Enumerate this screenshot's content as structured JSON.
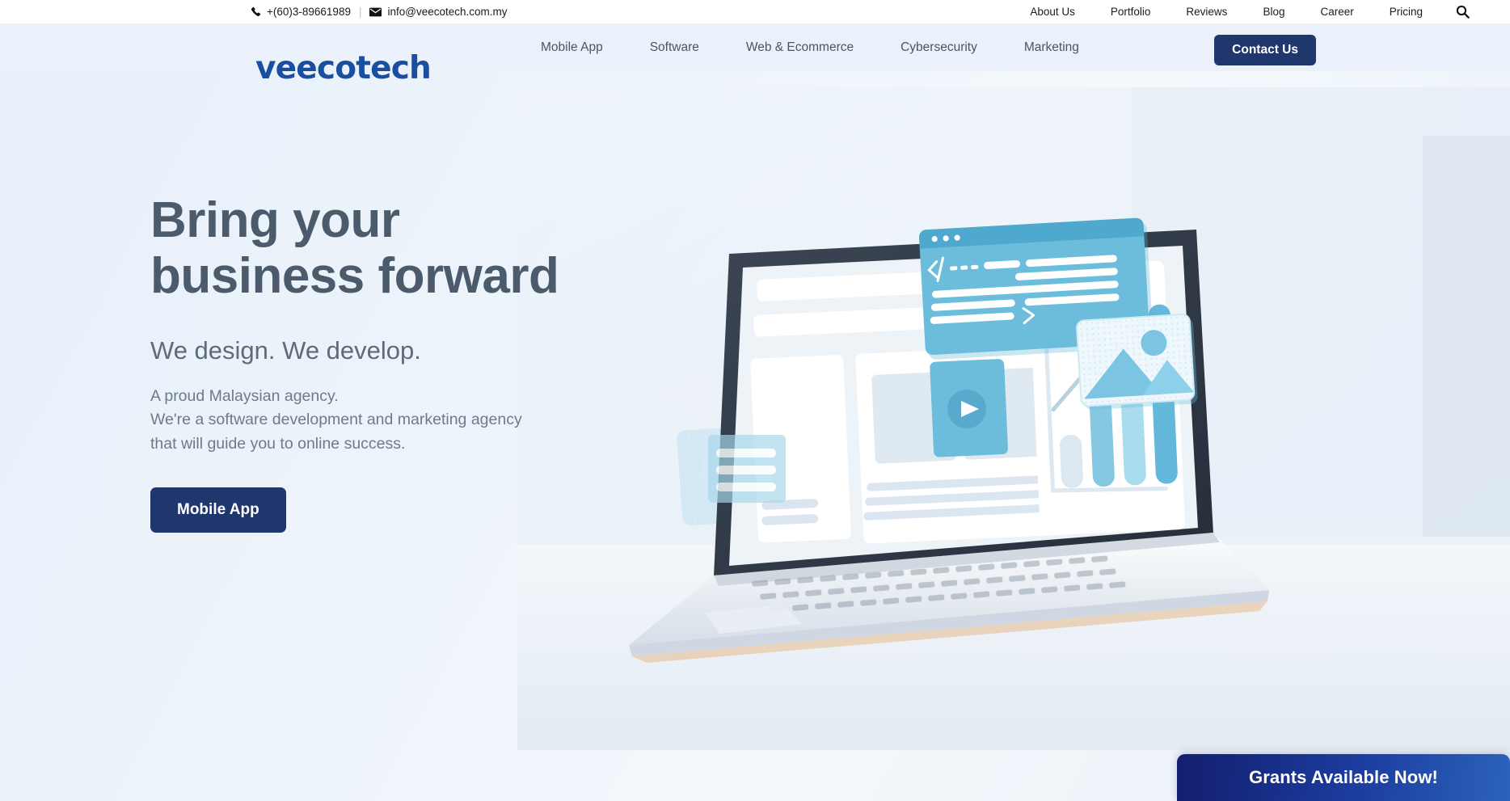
{
  "topbar": {
    "phone": "+(60)3-89661989",
    "separator": "|",
    "email": "info@veecotech.com.my",
    "phone_icon": "phone-icon",
    "email_icon": "envelope-icon",
    "search_icon": "search-icon",
    "links": [
      {
        "label": "About Us"
      },
      {
        "label": "Portfolio"
      },
      {
        "label": "Reviews"
      },
      {
        "label": "Blog"
      },
      {
        "label": "Career"
      },
      {
        "label": "Pricing"
      }
    ]
  },
  "nav": {
    "logo": "veecotech",
    "logo_color": "#1a4fa0",
    "items": [
      {
        "label": "Mobile App"
      },
      {
        "label": "Software"
      },
      {
        "label": "Web & Ecommerce"
      },
      {
        "label": "Cybersecurity"
      },
      {
        "label": "Marketing"
      }
    ],
    "contact_label": "Contact Us",
    "contact_color": "#20376e"
  },
  "hero": {
    "headline_line1": "Bring your",
    "headline_line2": "business forward",
    "subheadline": "We design. We develop.",
    "body_line1": "A proud Malaysian agency.",
    "body_line2": "We're a software development and marketing agency",
    "body_line3": "that will guide you to online success.",
    "cta_label": "Mobile App",
    "headline_color": "#4c5b6c",
    "accent_blue": "#6cbcdc"
  },
  "banner": {
    "label": "Grants Available Now!",
    "gradient_start": "#141e6e",
    "gradient_end": "#2b62bb"
  }
}
